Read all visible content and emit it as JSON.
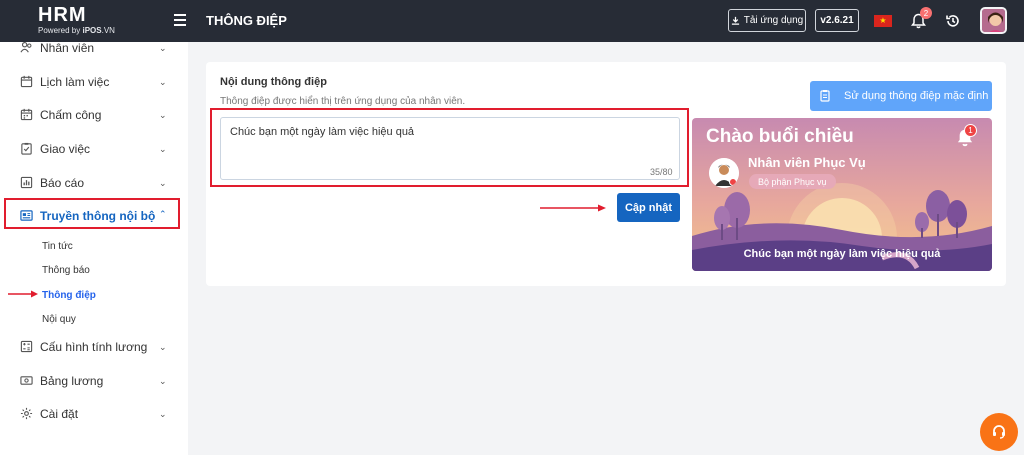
{
  "header": {
    "logo_main": "HRM",
    "logo_sub_prefix": "Powered by ",
    "logo_sub_brand": "iPOS",
    "logo_sub_suffix": ".VN",
    "page_title": "THÔNG ĐIỆP",
    "download_label": "Tải ứng dụng",
    "version": "v2.6.21",
    "notification_count": "2",
    "flag_star": "★"
  },
  "sidebar": {
    "items": [
      {
        "label": "Nhân viên",
        "icon": "users-icon"
      },
      {
        "label": "Lịch làm việc",
        "icon": "calendar-icon"
      },
      {
        "label": "Chấm công",
        "icon": "calendar-grid-icon"
      },
      {
        "label": "Giao việc",
        "icon": "task-check-icon"
      },
      {
        "label": "Báo cáo",
        "icon": "bar-chart-icon"
      },
      {
        "label": "Truyền thông nội bộ",
        "icon": "newspaper-icon"
      },
      {
        "label": "Cấu hình tính lương",
        "icon": "calculator-icon"
      },
      {
        "label": "Bảng lương",
        "icon": "money-icon"
      },
      {
        "label": "Cài đặt",
        "icon": "gear-icon"
      }
    ],
    "sub_items": [
      "Tin tức",
      "Thông báo",
      "Thông điệp",
      "Nội quy"
    ]
  },
  "main": {
    "title": "Nội dung thông điệp",
    "description": "Thông điệp được hiển thị trên ứng dụng của nhân viên.",
    "message_value": "Chúc bạn một ngày làm việc hiệu quả",
    "counter": "35/80",
    "update_label": "Cập nhật",
    "default_label": "Sử dụng thông điệp mặc định"
  },
  "preview": {
    "greeting": "Chào buổi chiều",
    "notification_count": "1",
    "employee_name": "Nhân viên Phục Vụ",
    "department": "Bộ phận Phục vụ",
    "message": "Chúc bạn một ngày làm việc hiệu quả"
  },
  "colors": {
    "topbar": "#272c36",
    "primary": "#1565c0",
    "highlight": "#e11d2e",
    "active_link": "#2563eb",
    "support": "#f97316"
  }
}
